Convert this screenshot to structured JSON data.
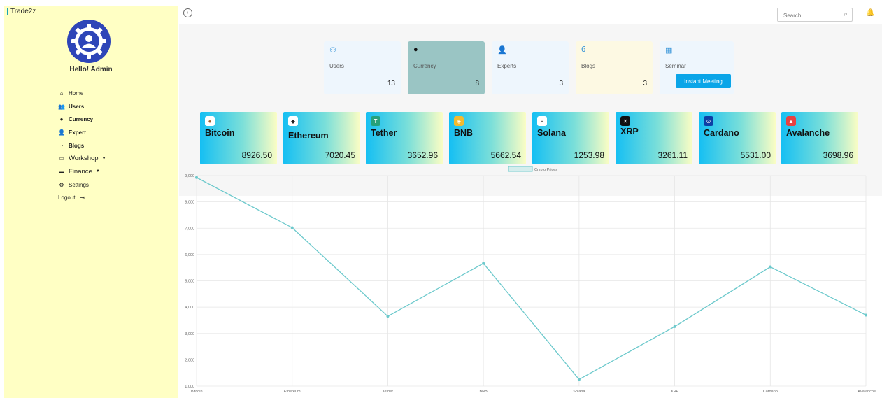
{
  "brand": "Trade2z",
  "greeting": "Hello! Admin",
  "nav": [
    {
      "label": "Home",
      "icon": "home-icon"
    },
    {
      "label": "Users",
      "icon": "users-icon"
    },
    {
      "label": "Currency",
      "icon": "currency-icon"
    },
    {
      "label": "Expert",
      "icon": "expert-icon"
    },
    {
      "label": "Blogs",
      "icon": "blogs-icon"
    },
    {
      "label": "Workshop",
      "icon": "workshop-icon"
    },
    {
      "label": "Finance",
      "icon": "finance-icon"
    },
    {
      "label": "Settings",
      "icon": "settings-icon"
    },
    {
      "label": "Logout",
      "icon": "logout-icon"
    }
  ],
  "search": {
    "placeholder": "Search"
  },
  "stats": [
    {
      "label": "Users",
      "count": "13",
      "icon": "users-group-icon",
      "color": "#eef6fd"
    },
    {
      "label": "Currency",
      "count": "8",
      "icon": "bitcoin-icon",
      "color": "#9ac5c4"
    },
    {
      "label": "Experts",
      "count": "3",
      "icon": "expert-icon",
      "color": "#eef6fd"
    },
    {
      "label": "Blogs",
      "count": "3",
      "icon": "blog-icon",
      "color": "#fdf9e3"
    },
    {
      "label": "Seminar",
      "count": "",
      "icon": "calendar-icon",
      "color": "#eef6fd"
    }
  ],
  "instant_meeting": "Instant Meeting",
  "cryptos": [
    {
      "name": "Bitcoin",
      "value": "8926.50",
      "icon": "bitcoin-icon"
    },
    {
      "name": "Ethereum",
      "value": "7020.45",
      "icon": "ethereum-icon"
    },
    {
      "name": "Tether",
      "value": "3652.96",
      "icon": "tether-icon"
    },
    {
      "name": "BNB",
      "value": "5662.54",
      "icon": "bnb-icon"
    },
    {
      "name": "Solana",
      "value": "1253.98",
      "icon": "solana-icon"
    },
    {
      "name": "XRP",
      "value": "3261.11",
      "icon": "xrp-icon"
    },
    {
      "name": "Cardano",
      "value": "5531.00",
      "icon": "cardano-icon"
    },
    {
      "name": "Avalanche",
      "value": "3698.96",
      "icon": "avalanche-icon"
    }
  ],
  "colors": {
    "sidebar": "#ffffc4",
    "accent": "#0aa5e8",
    "line": "#6cc9cc"
  },
  "chart_data": {
    "type": "line",
    "legend": "Crypto Prices",
    "legend_position": "top-center",
    "categories": [
      "Bitcoin",
      "Ethereum",
      "Tether",
      "BNB",
      "Solana",
      "XRP",
      "Cardano",
      "Avalanche"
    ],
    "series": [
      {
        "name": "Crypto Prices",
        "values": [
          8926.5,
          7020.45,
          3652.96,
          5662.54,
          1253.98,
          3261.11,
          5531.0,
          3698.96
        ]
      }
    ],
    "ylim": [
      1000,
      9000
    ],
    "yticks": [
      "1,000",
      "2,000",
      "3,000",
      "4,000",
      "5,000",
      "6,000",
      "7,000",
      "8,000",
      "9,000"
    ],
    "grid": true
  }
}
